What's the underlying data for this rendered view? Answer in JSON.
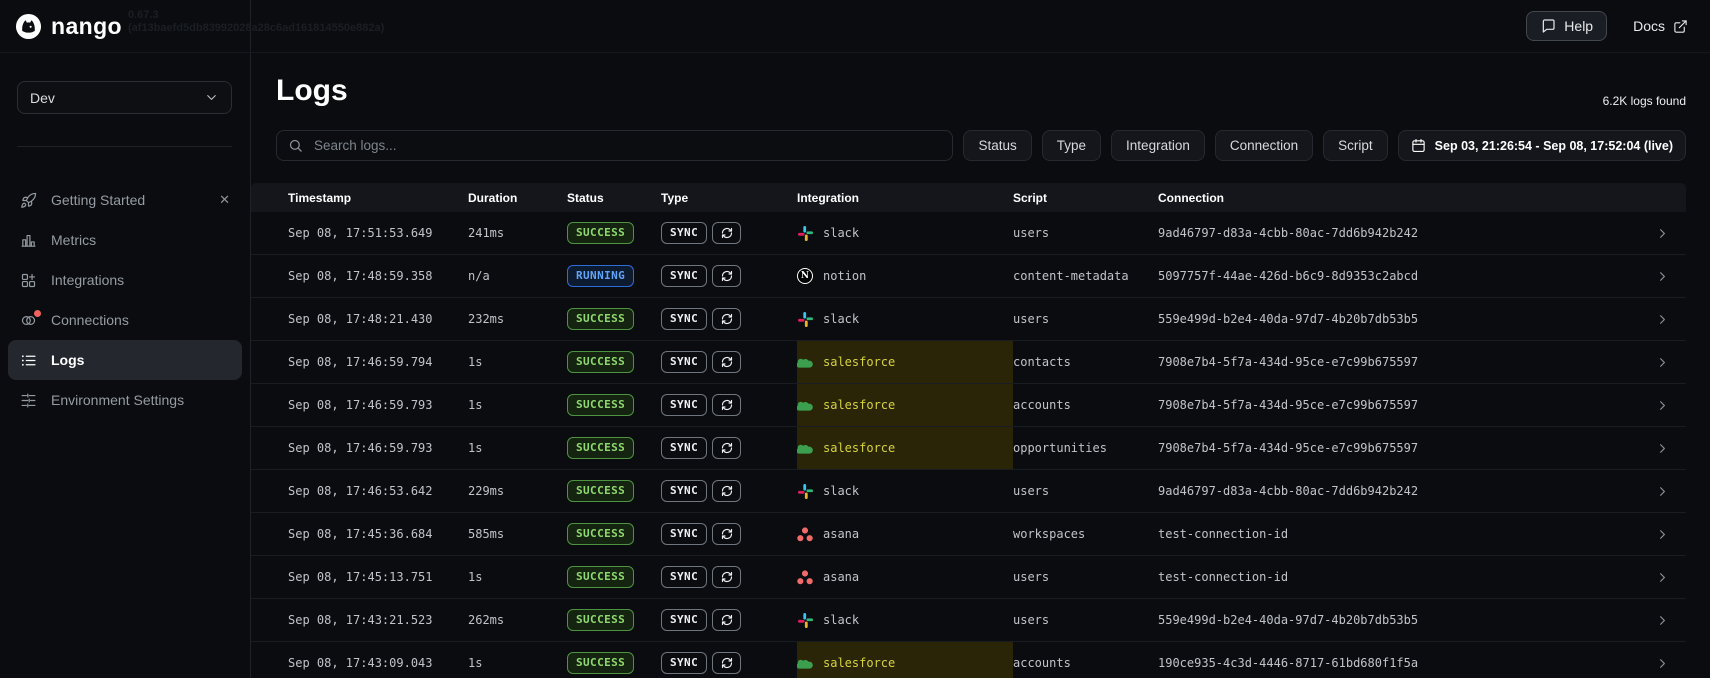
{
  "topbar": {
    "logo_text": "nango",
    "version_line1": "0.67.3",
    "version_line2": "(af13baefd5db83992028a28c6ad161814550e882a)",
    "help_label": "Help",
    "docs_label": "Docs"
  },
  "sidebar": {
    "environment": "Dev",
    "items": [
      {
        "label": "Getting Started",
        "icon": "rocket-icon",
        "active": false,
        "closable": true
      },
      {
        "label": "Metrics",
        "icon": "bar-chart-icon",
        "active": false
      },
      {
        "label": "Integrations",
        "icon": "grid-plus-icon",
        "active": false
      },
      {
        "label": "Connections",
        "icon": "rings-icon",
        "active": false,
        "notification_dot": true
      },
      {
        "label": "Logs",
        "icon": "list-icon",
        "active": true
      },
      {
        "label": "Environment Settings",
        "icon": "sliders-icon",
        "active": false
      }
    ]
  },
  "main": {
    "title": "Logs",
    "result_count": "6.2K logs found",
    "search_placeholder": "Search logs...",
    "filters": [
      "Status",
      "Type",
      "Integration",
      "Connection",
      "Script"
    ],
    "date_range": "Sep 03, 21:26:54 - Sep 08, 17:52:04 (live)",
    "table": {
      "columns": [
        "Timestamp",
        "Duration",
        "Status",
        "Type",
        "Integration",
        "Script",
        "Connection"
      ],
      "rows": [
        {
          "timestamp": "Sep 08, 17:51:53.649",
          "duration": "241ms",
          "status": "SUCCESS",
          "type": "SYNC",
          "integration": "slack",
          "integration_icon": "slack-icon",
          "script": "users",
          "connection": "9ad46797-d83a-4cbb-80ac-7dd6b942b242",
          "highlighted": false
        },
        {
          "timestamp": "Sep 08, 17:48:59.358",
          "duration": "n/a",
          "status": "RUNNING",
          "type": "SYNC",
          "integration": "notion",
          "integration_icon": "notion-icon",
          "script": "content-metadata",
          "connection": "5097757f-44ae-426d-b6c9-8d9353c2abcd",
          "highlighted": false
        },
        {
          "timestamp": "Sep 08, 17:48:21.430",
          "duration": "232ms",
          "status": "SUCCESS",
          "type": "SYNC",
          "integration": "slack",
          "integration_icon": "slack-icon",
          "script": "users",
          "connection": "559e499d-b2e4-40da-97d7-4b20b7db53b5",
          "highlighted": false
        },
        {
          "timestamp": "Sep 08, 17:46:59.794",
          "duration": "1s",
          "status": "SUCCESS",
          "type": "SYNC",
          "integration": "salesforce",
          "integration_icon": "salesforce-icon",
          "script": "contacts",
          "connection": "7908e7b4-5f7a-434d-95ce-e7c99b675597",
          "highlighted": true
        },
        {
          "timestamp": "Sep 08, 17:46:59.793",
          "duration": "1s",
          "status": "SUCCESS",
          "type": "SYNC",
          "integration": "salesforce",
          "integration_icon": "salesforce-icon",
          "script": "accounts",
          "connection": "7908e7b4-5f7a-434d-95ce-e7c99b675597",
          "highlighted": true
        },
        {
          "timestamp": "Sep 08, 17:46:59.793",
          "duration": "1s",
          "status": "SUCCESS",
          "type": "SYNC",
          "integration": "salesforce",
          "integration_icon": "salesforce-icon",
          "script": "opportunities",
          "connection": "7908e7b4-5f7a-434d-95ce-e7c99b675597",
          "highlighted": true
        },
        {
          "timestamp": "Sep 08, 17:46:53.642",
          "duration": "229ms",
          "status": "SUCCESS",
          "type": "SYNC",
          "integration": "slack",
          "integration_icon": "slack-icon",
          "script": "users",
          "connection": "9ad46797-d83a-4cbb-80ac-7dd6b942b242",
          "highlighted": false
        },
        {
          "timestamp": "Sep 08, 17:45:36.684",
          "duration": "585ms",
          "status": "SUCCESS",
          "type": "SYNC",
          "integration": "asana",
          "integration_icon": "asana-icon",
          "script": "workspaces",
          "connection": "test-connection-id",
          "highlighted": false
        },
        {
          "timestamp": "Sep 08, 17:45:13.751",
          "duration": "1s",
          "status": "SUCCESS",
          "type": "SYNC",
          "integration": "asana",
          "integration_icon": "asana-icon",
          "script": "users",
          "connection": "test-connection-id",
          "highlighted": false
        },
        {
          "timestamp": "Sep 08, 17:43:21.523",
          "duration": "262ms",
          "status": "SUCCESS",
          "type": "SYNC",
          "integration": "slack",
          "integration_icon": "slack-icon",
          "script": "users",
          "connection": "559e499d-b2e4-40da-97d7-4b20b7db53b5",
          "highlighted": false
        },
        {
          "timestamp": "Sep 08, 17:43:09.043",
          "duration": "1s",
          "status": "SUCCESS",
          "type": "SYNC",
          "integration": "salesforce",
          "integration_icon": "salesforce-icon",
          "script": "accounts",
          "connection": "190ce935-4c3d-4446-8717-61bd680f1f5a",
          "highlighted": true
        }
      ]
    }
  },
  "colors": {
    "success_text": "#90d96e",
    "success_border": "#4d9440",
    "running_text": "#61a5f9",
    "running_border": "#2e6cd6",
    "highlight_text": "#d6d33c",
    "highlight_bg": "#2a2507",
    "asana": "#f06a6a",
    "salesforce_cloud": "#3c9e4f",
    "notification_dot": "#f0625f"
  }
}
